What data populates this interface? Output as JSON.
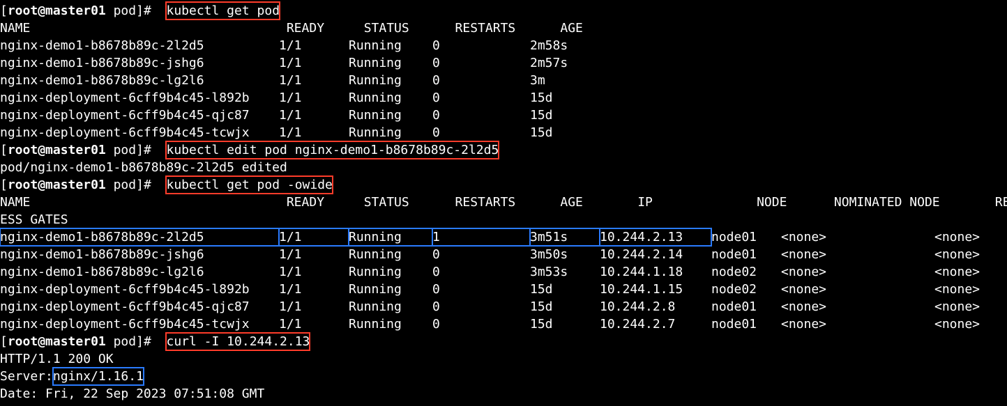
{
  "prompt": {
    "open": "[",
    "user": "root",
    "at": "@",
    "host": "master01",
    "dir": "pod",
    "close": "]#"
  },
  "cmd1": "kubectl get pod",
  "hdr1": {
    "name": "NAME",
    "ready": "READY",
    "status": "STATUS",
    "restarts": "RESTARTS",
    "age": "AGE"
  },
  "pods1": [
    {
      "name": "nginx-demo1-b8678b89c-2l2d5",
      "ready": "1/1",
      "status": "Running",
      "restarts": "0",
      "age": "2m58s"
    },
    {
      "name": "nginx-demo1-b8678b89c-jshg6",
      "ready": "1/1",
      "status": "Running",
      "restarts": "0",
      "age": "2m57s"
    },
    {
      "name": "nginx-demo1-b8678b89c-lg2l6",
      "ready": "1/1",
      "status": "Running",
      "restarts": "0",
      "age": "3m"
    },
    {
      "name": "nginx-deployment-6cff9b4c45-l892b",
      "ready": "1/1",
      "status": "Running",
      "restarts": "0",
      "age": "15d"
    },
    {
      "name": "nginx-deployment-6cff9b4c45-qjc87",
      "ready": "1/1",
      "status": "Running",
      "restarts": "0",
      "age": "15d"
    },
    {
      "name": "nginx-deployment-6cff9b4c45-tcwjx",
      "ready": "1/1",
      "status": "Running",
      "restarts": "0",
      "age": "15d"
    }
  ],
  "cmd2": "kubectl edit pod nginx-demo1-b8678b89c-2l2d5",
  "editResult": "pod/nginx-demo1-b8678b89c-2l2d5 edited",
  "cmd3": "kubectl get pod -owide",
  "hdr2": {
    "name": "NAME",
    "ready": "READY",
    "status": "STATUS",
    "restarts": "RESTARTS",
    "age": "AGE",
    "ip": "IP",
    "node": "NODE",
    "nom": "NOMINATED NODE",
    "rdg": "READIN"
  },
  "wrap2": "ESS GATES",
  "pods2": [
    {
      "name": "nginx-demo1-b8678b89c-2l2d5",
      "ready": "1/1",
      "status": "Running",
      "restarts": "1",
      "age": "3m51s",
      "ip": "10.244.2.13",
      "node": "node01",
      "nom": "<none>",
      "rdg": "<none>"
    },
    {
      "name": "nginx-demo1-b8678b89c-jshg6",
      "ready": "1/1",
      "status": "Running",
      "restarts": "0",
      "age": "3m50s",
      "ip": "10.244.2.14",
      "node": "node01",
      "nom": "<none>",
      "rdg": "<none>"
    },
    {
      "name": "nginx-demo1-b8678b89c-lg2l6",
      "ready": "1/1",
      "status": "Running",
      "restarts": "0",
      "age": "3m53s",
      "ip": "10.244.1.18",
      "node": "node02",
      "nom": "<none>",
      "rdg": "<none>"
    },
    {
      "name": "nginx-deployment-6cff9b4c45-l892b",
      "ready": "1/1",
      "status": "Running",
      "restarts": "0",
      "age": "15d",
      "ip": "10.244.1.15",
      "node": "node02",
      "nom": "<none>",
      "rdg": "<none>"
    },
    {
      "name": "nginx-deployment-6cff9b4c45-qjc87",
      "ready": "1/1",
      "status": "Running",
      "restarts": "0",
      "age": "15d",
      "ip": "10.244.2.8",
      "node": "node01",
      "nom": "<none>",
      "rdg": "<none>"
    },
    {
      "name": "nginx-deployment-6cff9b4c45-tcwjx",
      "ready": "1/1",
      "status": "Running",
      "restarts": "0",
      "age": "15d",
      "ip": "10.244.2.7",
      "node": "node01",
      "nom": "<none>",
      "rdg": "<none>"
    }
  ],
  "cmd4": "curl -I 10.244.2.13",
  "curl": {
    "httpLine": "HTTP/1.1 200 OK",
    "serverLabel": "Server: ",
    "serverValue": "nginx/1.16.1",
    "dateLine": "Date: Fri, 22 Sep 2023 07:51:08 GMT"
  }
}
